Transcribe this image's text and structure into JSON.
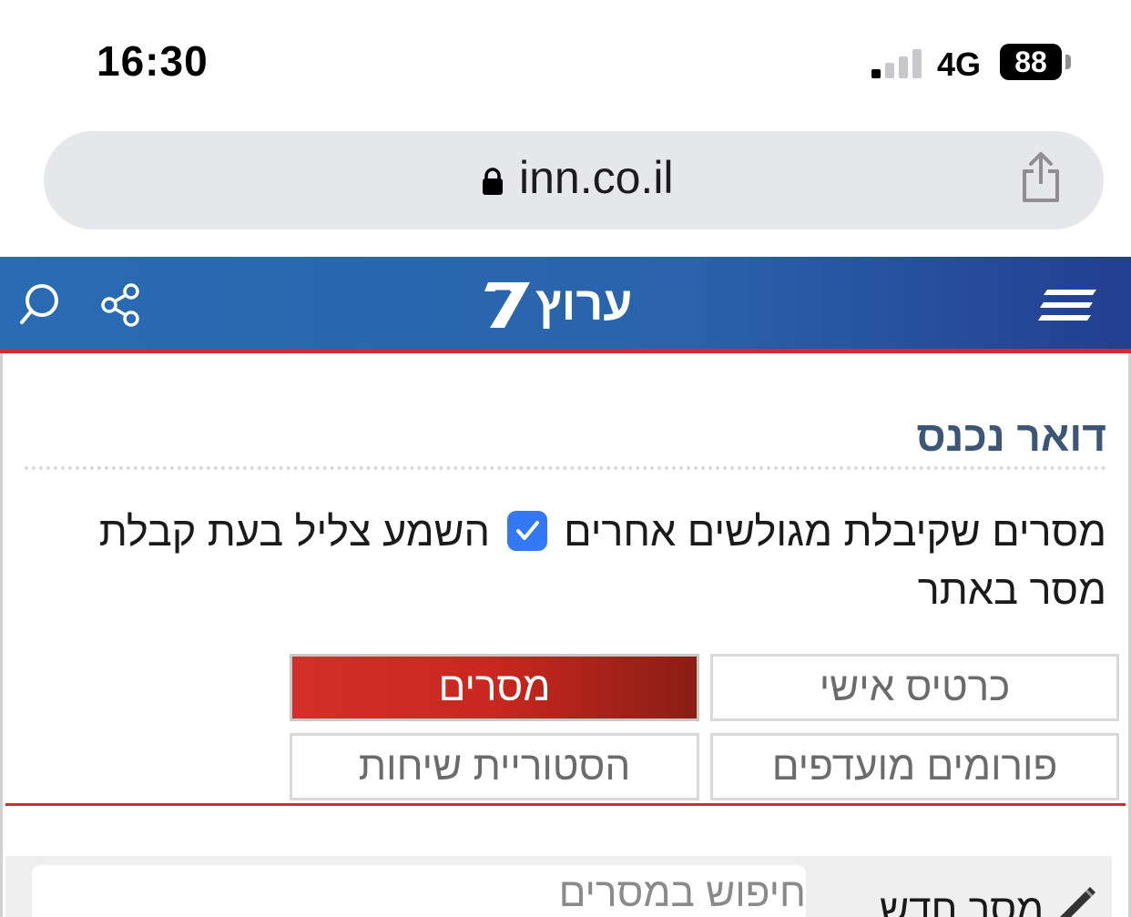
{
  "status_bar": {
    "time": "16:30",
    "network": "4G",
    "battery": "88"
  },
  "browser": {
    "url": "inn.co.il"
  },
  "site": {
    "logo_text": "ערוץ"
  },
  "inbox": {
    "title": "דואר נכנס",
    "notice_part1": "מסרים שקיבלת מגולשים אחרים",
    "notice_part2": "השמע צליל בעת קבלת מסר באתר",
    "sound_checkbox_checked": true
  },
  "tabs": {
    "profile": "כרטיס אישי",
    "messages": "מסרים",
    "forums": "פורומים מועדפים",
    "history": "הסטוריית שיחות"
  },
  "toolbar": {
    "search_placeholder": "חיפוש במסרים",
    "new_message": "מסר חדש"
  },
  "colors": {
    "header_blue": "#2a6bb3",
    "accent_red": "#d52b2b",
    "checkbox_blue": "#3478f6",
    "title_color": "#3e5675"
  }
}
